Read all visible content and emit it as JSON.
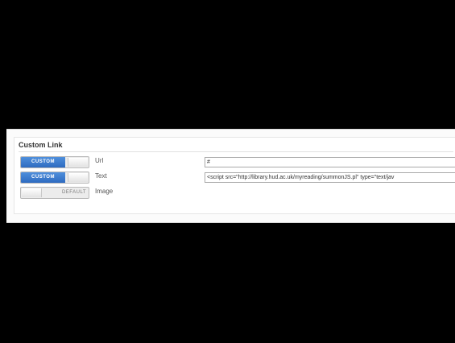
{
  "section": {
    "title": "Custom Link"
  },
  "rows": [
    {
      "toggle_state": "CUSTOM",
      "label": "Url",
      "value": "#"
    },
    {
      "toggle_state": "CUSTOM",
      "label": "Text",
      "value": "<script src=\"http://library.hud.ac.uk/myreading/summonJS.pl\" type=\"text/jav"
    },
    {
      "toggle_state": "DEFAULT",
      "label": "Image"
    }
  ],
  "colors": {
    "toggle_on": "#2e6bc0",
    "background": "#000000",
    "panel": "#ffffff"
  }
}
